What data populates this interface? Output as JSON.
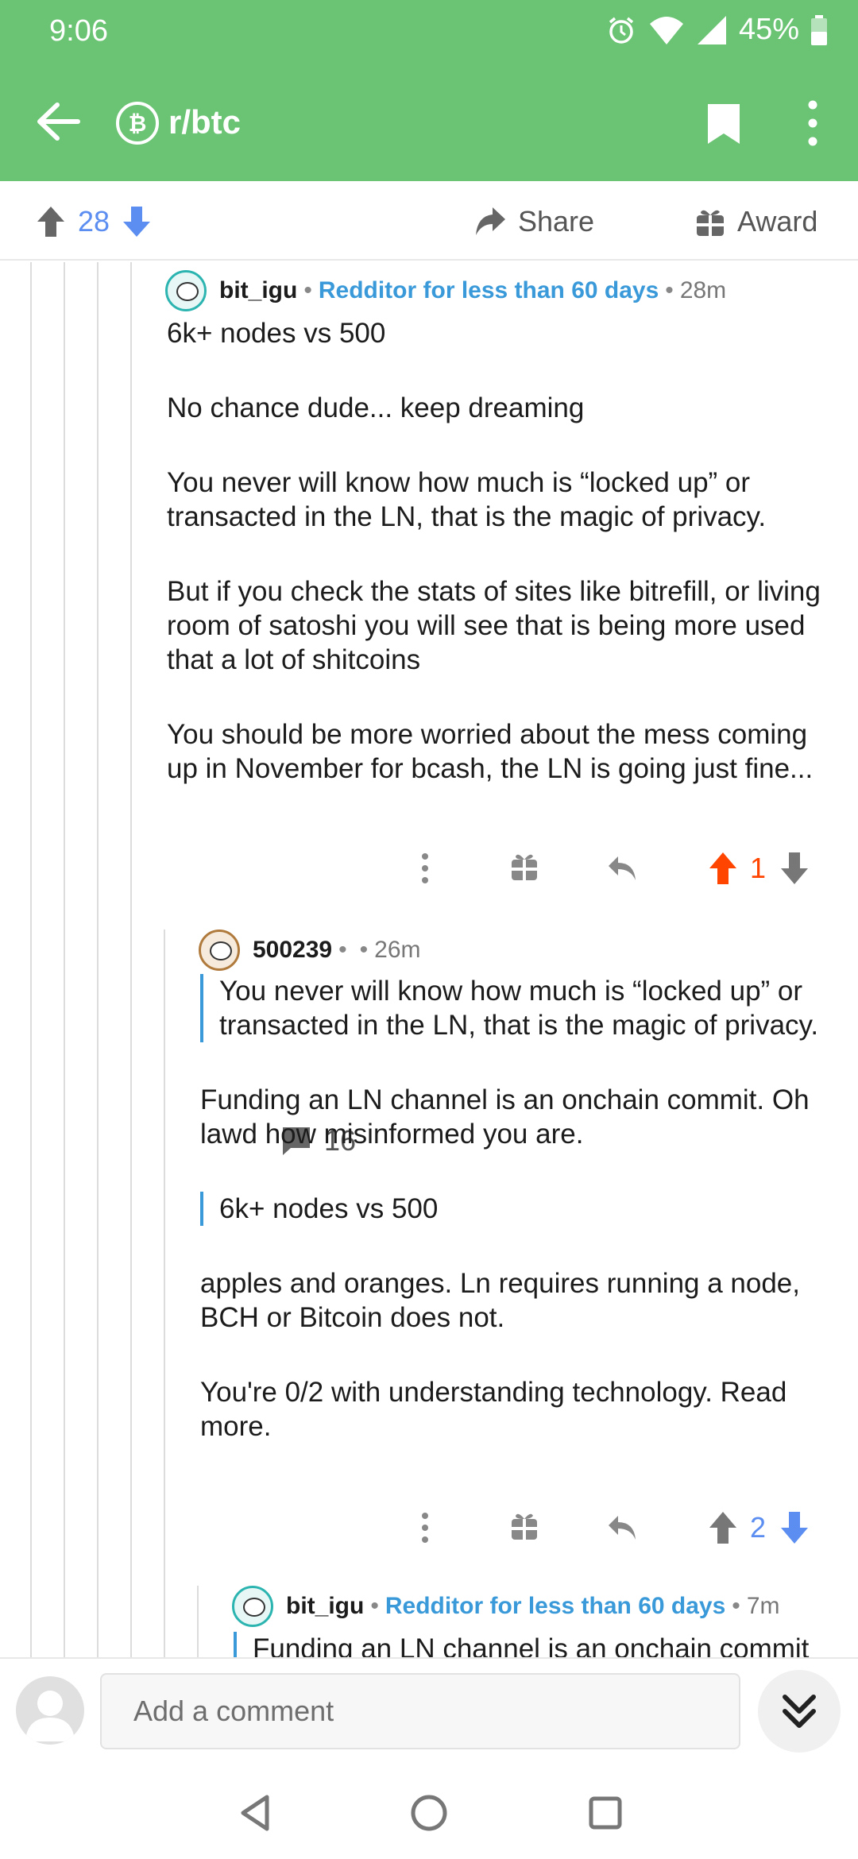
{
  "status_bar": {
    "time": "9:06",
    "battery": "45%"
  },
  "header": {
    "title": "r/btc",
    "back_icon": "arrow-left-icon",
    "bookmark_icon": "bookmark-icon",
    "more_icon": "more-vertical-icon"
  },
  "post_actions": {
    "score": "28",
    "comments": "16",
    "share": "Share",
    "award": "Award"
  },
  "comments": [
    {
      "author": "bit_igu",
      "flair": "Redditor for less than 60 days",
      "time": "28m",
      "paragraphs": [
        "6k+ nodes vs 500",
        "No chance dude... keep dreaming",
        "You never will know how much is “locked up” or transacted in the LN, that is the magic of privacy.",
        "But if you check the stats of sites like bitrefill, or living room of satoshi you will see that is being more used that a lot of shitcoins",
        "You should be more worried about the mess coming up in November for bcash, the LN is going just fine..."
      ],
      "score": "1",
      "vote_state": "upvoted"
    },
    {
      "author": "500239",
      "time": "26m",
      "quote1": "You never will know how much is “locked up” or transacted in the LN, that is the magic of privacy.",
      "p1": "Funding an LN channel is an onchain commit. Oh lawd how misinformed you are.",
      "quote2": "6k+ nodes vs 500",
      "p2": "apples and oranges. Ln requires running a node, BCH or Bitcoin does not.",
      "p3": "You're 0/2 with understanding technology. Read more.",
      "score": "2"
    },
    {
      "author": "bit_igu",
      "flair": "Redditor for less than 60 days",
      "time": "7m",
      "quote": "Funding an LN channel is an onchain commit"
    }
  ],
  "comment_bar": {
    "placeholder": "Add a comment"
  },
  "colors": {
    "header": "#6bc474",
    "flair": "#3a9ad9",
    "upvote": "#ff4500",
    "downvote": "#5b8ef0"
  }
}
